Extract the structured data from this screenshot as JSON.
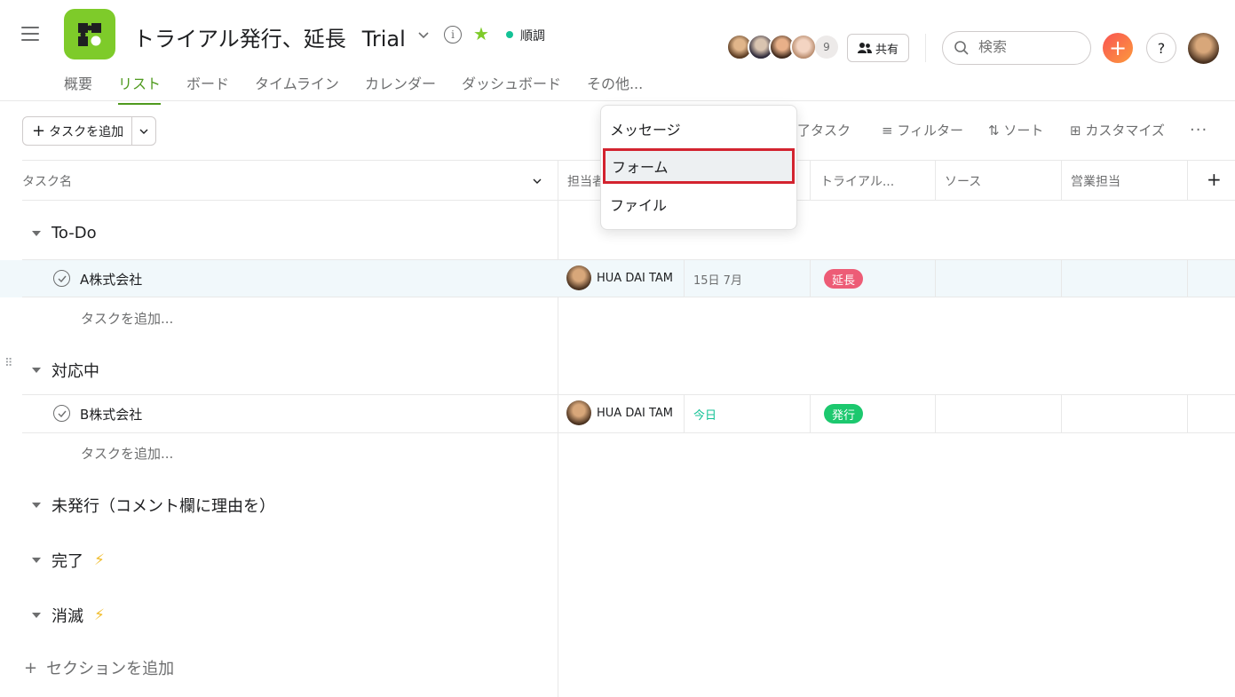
{
  "project": {
    "title": "トライアル発行、延長",
    "suffix": "Trial",
    "status": "順調",
    "member_count": "9",
    "share_label": "共有"
  },
  "search": {
    "placeholder": "検索"
  },
  "tabs": [
    "概要",
    "リスト",
    "ボード",
    "タイムライン",
    "カレンダー",
    "ダッシュボード",
    "その他..."
  ],
  "toolbar": {
    "add_task": "タスクを追加",
    "completed": "了タスク",
    "filter": "フィルター",
    "sort": "ソート",
    "customize": "カスタマイズ"
  },
  "columns": [
    "タスク名",
    "担当者",
    "トライアル...",
    "ソース",
    "営業担当"
  ],
  "sections": [
    "To-Do",
    "対応中",
    "未発行（コメント欄に理由を）",
    "完了",
    "消滅"
  ],
  "tasks": [
    {
      "name": "A株式会社",
      "assignee": "HUA DAI TAM",
      "date": "15日 7月",
      "tag": "延長",
      "tag_color": "#ed5c76"
    },
    {
      "name": "B株式会社",
      "assignee": "HUA DAI TAM",
      "date": "今日",
      "tag": "発行",
      "tag_color": "#1cc86e"
    }
  ],
  "add_subtask": "タスクを追加...",
  "add_section": "セクションを追加",
  "menu": {
    "items": [
      "メッセージ",
      "フォーム",
      "ファイル"
    ],
    "selected": "フォーム"
  },
  "colors": {
    "accent": "#4f9a1e",
    "highlight": "#d3232f"
  }
}
